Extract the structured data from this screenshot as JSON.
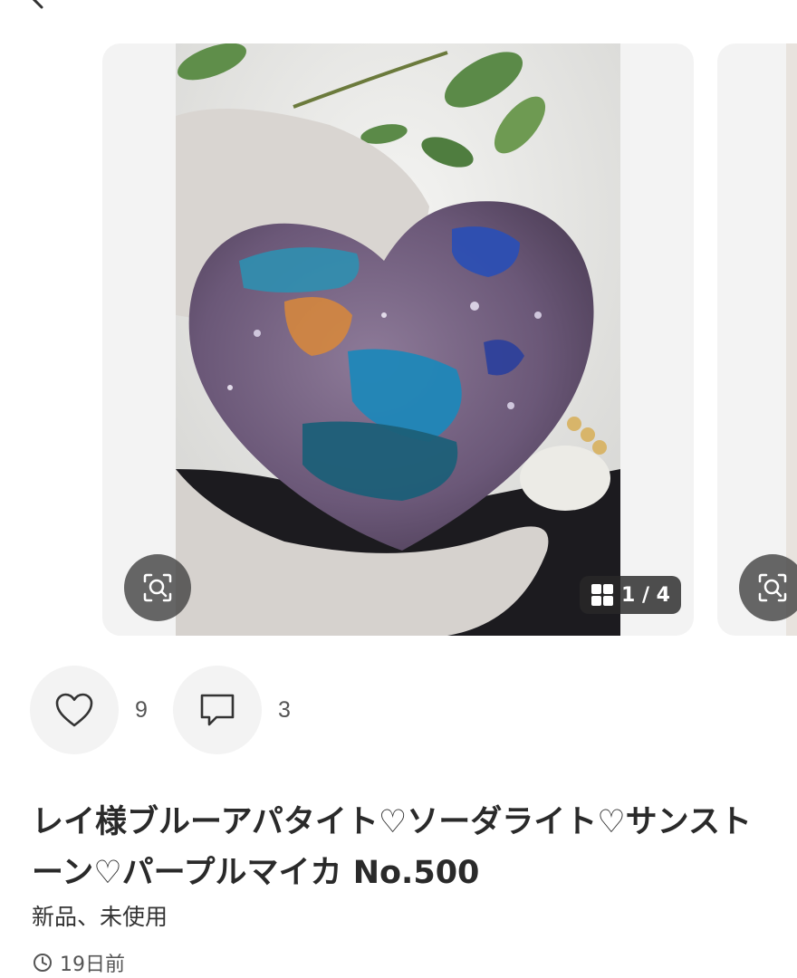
{
  "nav": {
    "back_icon": "chevron-left-icon"
  },
  "gallery": {
    "image_counter": "1 / 4",
    "current_image": 1,
    "total_images": 4,
    "zoom_icon": "zoom-search-icon",
    "grid_icon": "grid-icon"
  },
  "actions": {
    "like_icon": "heart-icon",
    "like_count": "9",
    "comment_icon": "comment-icon",
    "comment_count": "3"
  },
  "product": {
    "title": "レイ様ブルーアパタイト♡ソーダライト♡サンストーン♡パープルマイカ No.500",
    "condition": "新品、未使用",
    "posted_ago": "19日前",
    "posted_icon": "clock-icon"
  },
  "colors": {
    "card_bg": "#f3f3f3",
    "overlay_bg": "#3c3c3c",
    "text_primary": "#2a2a2a",
    "text_secondary": "#555555"
  }
}
